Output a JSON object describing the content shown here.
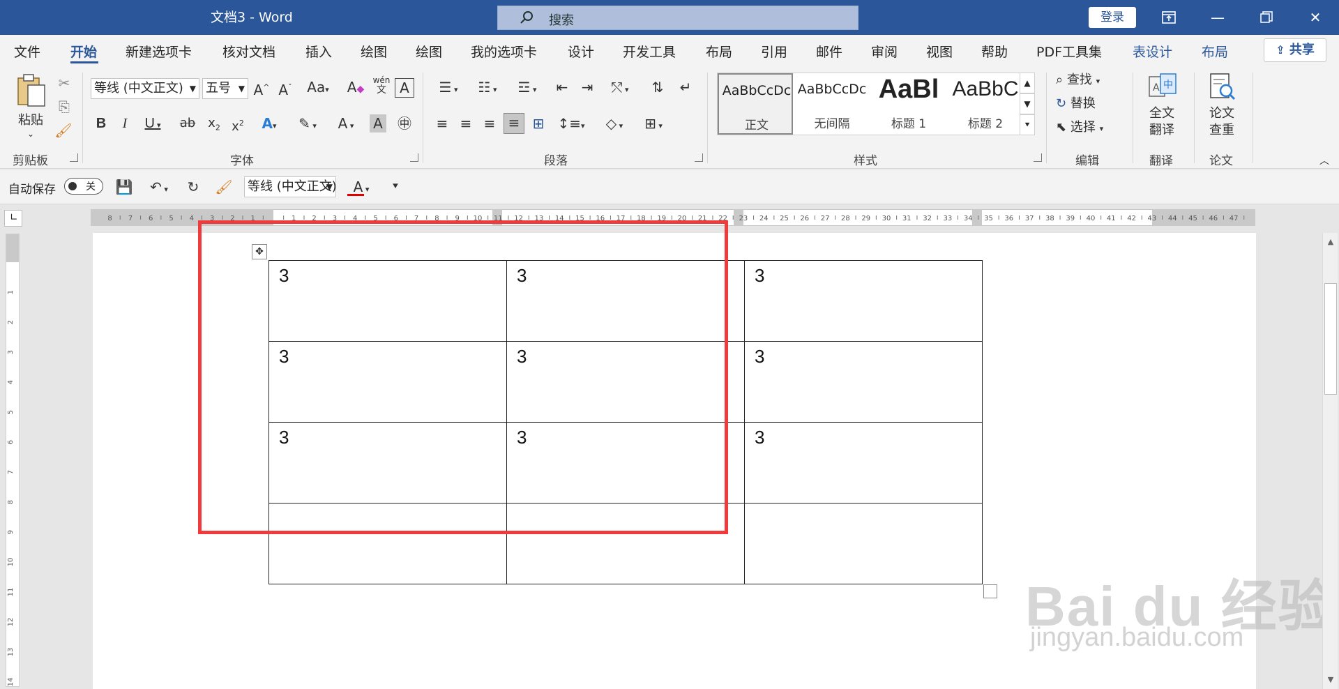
{
  "titlebar": {
    "doc_title": "文档3 - Word",
    "search_placeholder": "搜索",
    "login_label": "登录"
  },
  "tabs": [
    "文件",
    "开始",
    "新建选项卡",
    "核对文档",
    "插入",
    "绘图",
    "绘图",
    "我的选项卡",
    "设计",
    "开发工具",
    "布局",
    "引用",
    "邮件",
    "审阅",
    "视图",
    "帮助",
    "PDF工具集",
    "表设计",
    "布局"
  ],
  "share_label": "共享",
  "ribbon": {
    "clipboard": {
      "paste_label": "粘贴",
      "group_label": "剪贴板"
    },
    "font": {
      "font_name": "等线 (中文正文)",
      "font_size": "五号",
      "group_label": "字体",
      "pinyin_top": "wén",
      "pinyin_bottom": "文"
    },
    "paragraph": {
      "group_label": "段落"
    },
    "styles": {
      "group_label": "样式",
      "items": [
        {
          "preview": "AaBbCcDc",
          "name": "正文"
        },
        {
          "preview": "AaBbCcDc",
          "name": "无间隔"
        },
        {
          "preview": "AaBl",
          "name": "标题 1"
        },
        {
          "preview": "AaBbC",
          "name": "标题 2"
        }
      ]
    },
    "editing": {
      "find_label": "查找",
      "replace_label": "替换",
      "select_label": "选择",
      "group_label": "编辑"
    },
    "translate": {
      "button_line1": "全文",
      "button_line2": "翻译",
      "group_label": "翻译"
    },
    "paper": {
      "button_line1": "论文",
      "button_line2": "查重",
      "group_label": "论文"
    }
  },
  "qat": {
    "autosave_label": "自动保存",
    "toggle_state": "关",
    "font_name": "等线 (中文正文)"
  },
  "table": {
    "rows": [
      [
        "3",
        "3",
        "3"
      ],
      [
        "3",
        "3",
        "3"
      ],
      [
        "3",
        "3",
        "3"
      ],
      [
        "",
        "",
        ""
      ]
    ]
  },
  "watermark": {
    "line1": "Bai du 经验",
    "line2": "jingyan.baidu.com"
  },
  "colors": {
    "accent": "#2b579a",
    "highlight_box": "#ef3b3b",
    "font_color": "#e00000",
    "highlight_color": "#ffe600"
  }
}
